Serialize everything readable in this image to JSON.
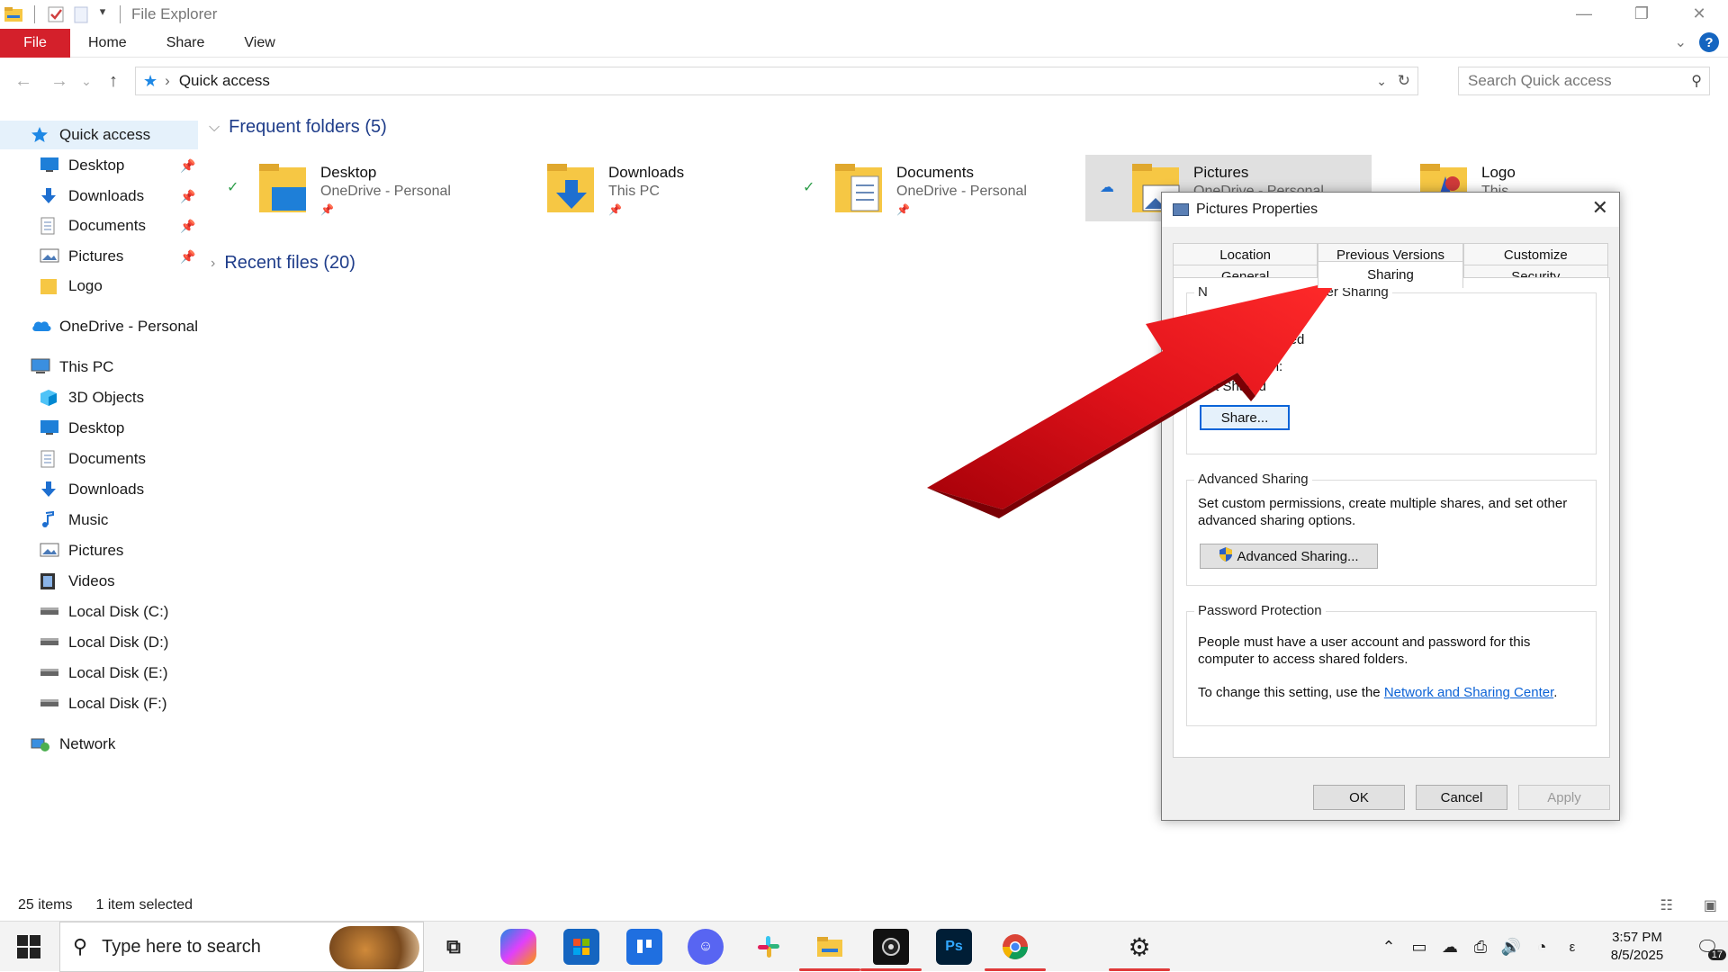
{
  "window": {
    "title": "File Explorer",
    "controls": {
      "minimize": "—",
      "restore": "❐",
      "close": "✕"
    }
  },
  "ribbon": {
    "tabs": [
      {
        "label": "File"
      },
      {
        "label": "Home"
      },
      {
        "label": "Share"
      },
      {
        "label": "View"
      }
    ],
    "expand_glyph": "⌄",
    "help_glyph": "?"
  },
  "navigation": {
    "back": "←",
    "forward": "→",
    "recent": "⌄",
    "up": "↑",
    "breadcrumb_sep": "›",
    "location": "Quick access",
    "refresh": "↻",
    "search_placeholder": "Search Quick access"
  },
  "sidebar": {
    "items": [
      {
        "label": "Quick access",
        "icon": "star-icon",
        "pinned": false
      },
      {
        "label": "Desktop",
        "icon": "desktop-icon",
        "pinned": true
      },
      {
        "label": "Downloads",
        "icon": "download-icon",
        "pinned": true
      },
      {
        "label": "Documents",
        "icon": "document-icon",
        "pinned": true
      },
      {
        "label": "Pictures",
        "icon": "pictures-icon",
        "pinned": true
      },
      {
        "label": "Logo",
        "icon": "folder-icon",
        "pinned": false
      },
      {
        "label": "OneDrive - Personal",
        "icon": "cloud-icon",
        "pinned": false
      },
      {
        "label": "This PC",
        "icon": "computer-icon",
        "pinned": false
      },
      {
        "label": "3D Objects",
        "icon": "cube-icon",
        "pinned": false
      },
      {
        "label": "Desktop",
        "icon": "desktop-icon",
        "pinned": false
      },
      {
        "label": "Documents",
        "icon": "document-icon",
        "pinned": false
      },
      {
        "label": "Downloads",
        "icon": "download-icon",
        "pinned": false
      },
      {
        "label": "Music",
        "icon": "music-icon",
        "pinned": false
      },
      {
        "label": "Pictures",
        "icon": "pictures-icon",
        "pinned": false
      },
      {
        "label": "Videos",
        "icon": "video-icon",
        "pinned": false
      },
      {
        "label": "Local Disk (C:)",
        "icon": "drive-icon",
        "pinned": false
      },
      {
        "label": "Local Disk (D:)",
        "icon": "drive-icon",
        "pinned": false
      },
      {
        "label": "Local Disk (E:)",
        "icon": "drive-icon",
        "pinned": false
      },
      {
        "label": "Local Disk (F:)",
        "icon": "drive-icon",
        "pinned": false
      },
      {
        "label": "Network",
        "icon": "network-icon",
        "pinned": false
      }
    ],
    "pin_glyph": "📌"
  },
  "content": {
    "frequent_title": "Frequent folders (5)",
    "recent_title": "Recent files (20)",
    "folders": [
      {
        "name": "Desktop",
        "sub": "OneDrive - Personal",
        "status": "✓",
        "pinned": "📌"
      },
      {
        "name": "Downloads",
        "sub": "This PC",
        "status": "",
        "pinned": "📌"
      },
      {
        "name": "Documents",
        "sub": "OneDrive - Personal",
        "status": "✓",
        "pinned": "📌"
      },
      {
        "name": "Pictures",
        "sub": "OneDrive - Personal",
        "status": "☁",
        "pinned": ""
      },
      {
        "name": "Logo",
        "sub": "This PC\\Downloads",
        "status": "",
        "pinned": ""
      }
    ]
  },
  "statusbar": {
    "count": "25 items",
    "selection": "1 item selected"
  },
  "dialog": {
    "title": "Pictures Properties",
    "close": "✕",
    "tabs_back": [
      "Location",
      "Previous Versions",
      "Customize"
    ],
    "tabs_front": [
      "General",
      "Sharing",
      "Security"
    ],
    "active_tab": "Sharing",
    "network_sharing": {
      "legend_start": "N",
      "legend_end": "lder Sharing",
      "item_partial": "s",
      "status_partial": "Shared",
      "path_label": "Network Path:",
      "path_value": "Not Shared",
      "share_button": "Share..."
    },
    "advanced_sharing": {
      "legend": "Advanced Sharing",
      "description": "Set custom permissions, create multiple shares, and set other advanced sharing options.",
      "button": "Advanced Sharing..."
    },
    "password_protection": {
      "legend": "Password Protection",
      "description": "People must have a user account and password for this computer to access shared folders.",
      "change_prefix": "To change this setting, use the ",
      "link": "Network and Sharing Center",
      "change_suffix": "."
    },
    "buttons": {
      "ok": "OK",
      "cancel": "Cancel",
      "apply": "Apply"
    }
  },
  "taskbar": {
    "search_placeholder": "Type here to search",
    "clock_time": "3:57 PM",
    "clock_date": "8/5/2025",
    "notification_count": "17",
    "photoshop_label": "Ps",
    "apps": [
      "task-view-icon",
      "copilot-icon",
      "store-icon",
      "trello-icon",
      "discord-icon",
      "slack-icon",
      "file-explorer-icon",
      "obs-icon",
      "photoshop-icon",
      "chrome-icon",
      "settings-icon"
    ]
  },
  "colors": {
    "accent_red": "#d4202b",
    "folder_yellow": "#f6c744",
    "link_blue": "#0b62d6",
    "arrow_red": "#e0121a",
    "selected_bg": "#e5f1fb"
  }
}
